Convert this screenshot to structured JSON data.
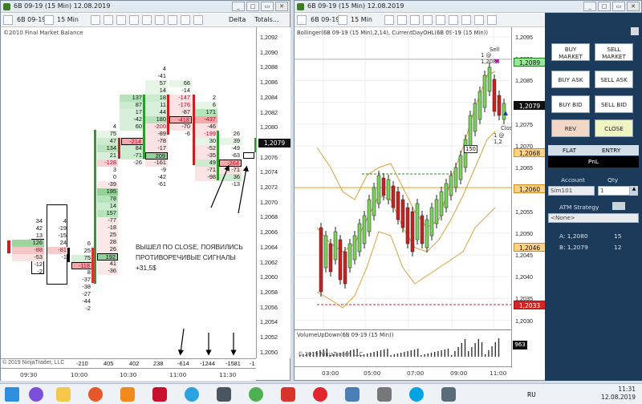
{
  "left": {
    "title": "6B 09-19 (15 Min)  12.08.2019",
    "toolbar": {
      "instrument": "6B 09-19",
      "interval": "15 Min",
      "type": "Delta",
      "totals": "Totals..."
    },
    "caption": "©2010 Final Market Balance",
    "note": "ВЫШЕЛ ПО CLOSE, ПОЯВИЛИСЬ ПРОТИВОРЕЧИВЫЕ СИГНАЛЫ +31,5$",
    "price_ticks": [
      "1,2092",
      "1,2090",
      "1,2088",
      "1,2086",
      "1,2084",
      "1,2082",
      "1,2080",
      "1,2078",
      "1,2076",
      "1,2074",
      "1,2072",
      "1,2070",
      "1,2068",
      "1,2066",
      "1,2064",
      "1,2062",
      "1,2060",
      "1,2058",
      "1,2056",
      "1,2054",
      "1,2052",
      "1,2050"
    ],
    "last_price": "1,2079",
    "bottom_totals": [
      "-210",
      "405",
      "402",
      "238",
      "-614",
      "-1244",
      "-1581",
      "-1"
    ],
    "copyright": "© 2019 NinjaTrader, LLC",
    "x_labels": [
      "09:30",
      "10:00",
      "10:30",
      "11:00",
      "11:30"
    ]
  },
  "right": {
    "title": "6B 09-19 (15 Min)  12.08.2019",
    "toolbar": {
      "instrument": "6B 09-19",
      "interval": "15 Min"
    },
    "indicator": "Bollinger(6B 09-19 (15 Min),2,14), CurrentDayOHL(6B 09-19 (15 Min))",
    "price_ticks": [
      "1,2095",
      "1,2090",
      "1,2085",
      "1,2080",
      "1,2075",
      "1,2070",
      "1,2065",
      "1,2060",
      "1,2055",
      "1,2050",
      "1,2045",
      "1,2040",
      "1,2035",
      "1,2030"
    ],
    "price_boxes": {
      "high": "1,2089",
      "last": "1,2079",
      "b1": "1,2068",
      "b2": "1,2060",
      "b3": "1,2046",
      "low": "1,2033"
    },
    "markers": {
      "sell": "Sell",
      "sell_fill": "1 @ 1,2084",
      "close": "Clos",
      "close_fill": "1 @ 1,2",
      "label150": "150"
    },
    "volume_label": "VolumeUpDown(6B 09-19 (15 Min))",
    "volume_value": "963",
    "copyright": "© 2019 NinjaTrader, LLC",
    "x_labels": [
      "03:00",
      "05:00",
      "07:00",
      "09:00",
      "11:00"
    ]
  },
  "panel": {
    "buttons": [
      "BUY MARKET",
      "SELL MARKET",
      "BUY ASK",
      "SELL ASK",
      "BUY BID",
      "SELL BID",
      "REV",
      "CLOSE"
    ],
    "flat": "FLAT",
    "entry": "ENTRY",
    "pnl": "PnL",
    "account_label": "Account",
    "qty_label": "Qty",
    "account_value": "Sim101",
    "qty_value": "1",
    "atm_label": "ATM Strategy",
    "atm_value": "<None>",
    "ask_label": "A: 1,2080",
    "ask_qty": "15",
    "bid_label": "B: 1,2079",
    "bid_qty": "12"
  },
  "taskbar": {
    "lang": "RU",
    "time": "11:31",
    "date": "12.08.2019"
  }
}
